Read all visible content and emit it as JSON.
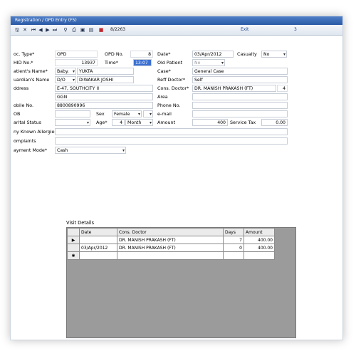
{
  "window": {
    "title": "Registration / OPD Entry (F5)"
  },
  "toolbar": {
    "record_no": "8/2263",
    "exit_label": "Exit",
    "page_no": "3",
    "icons": [
      "save-icon",
      "close-icon",
      "first-icon",
      "prev-icon",
      "next-icon",
      "last-icon",
      "binoculars-icon",
      "print-icon",
      "floppy-icon",
      "report-icon",
      "stop-icon"
    ]
  },
  "form": {
    "doc_type_label": "oc. Type*",
    "doc_type": "OPD",
    "opd_no_label": "OPD No.",
    "opd_no": "8",
    "date_label": "Date*",
    "date": "03/Apr/2012",
    "casualty_label": "Casualty",
    "casualty": "No",
    "uhid_label": "HID No.*",
    "uhid": "13937",
    "time_label": "Time*",
    "time": "13:07",
    "old_patient_label": "Old Patient",
    "old_patient": "No",
    "patient_name_label": "atient's Name*",
    "patient_title": "Baby.",
    "patient_name": "YUKTA",
    "case_label": "Case*",
    "case": "General Case",
    "guardian_label": "uardian's Name",
    "guardian_relation": "D/O",
    "guardian_name": "DIWAKAR JOSHI",
    "reff_doctor_label": "Reff Doctor*",
    "reff_doctor": "Self",
    "address_label": "ddress",
    "address_line1": "E-47, SOUTHCITY II",
    "address_line2": "GGN",
    "cons_doctor_label": "Cons. Doctor*",
    "cons_doctor": "DR. MANISH PRAKASH (FT)",
    "cons_doctor_code": "4",
    "area_label": "Area",
    "mobile_label": "obile No.",
    "mobile": "8800890996",
    "phone_label": "Phone No.",
    "dob_label": "OB",
    "sex_label": "Sex",
    "sex": "Female",
    "email_label": "e-mail",
    "marital_label": "arital Status",
    "age_label": "Age*",
    "age": "4",
    "age_unit": "Month",
    "amount_label": "Amount",
    "amount": "400",
    "service_tax_label": "Service Tax",
    "service_tax": "0.00",
    "allergies_label": "ny Known Allergies",
    "complaints_label": "omplaints",
    "payment_label": "ayment Mode*",
    "payment_mode": "Cash"
  },
  "visit_details": {
    "title": "Visit Details",
    "columns": [
      "Date",
      "Cons. Doctor",
      "Days",
      "Amount"
    ],
    "rows": [
      {
        "date": "08/Apr/2012",
        "doctor": "DR. MANISH PRAKASH (FT)",
        "days": "7",
        "amount": "400.00"
      },
      {
        "date": "03/Apr/2012",
        "doctor": "DR. MANISH PRAKASH (FT)",
        "days": "0",
        "amount": "400.00"
      }
    ]
  }
}
